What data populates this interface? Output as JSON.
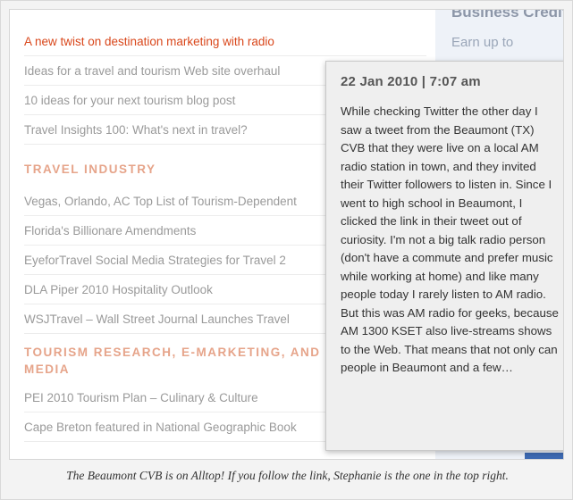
{
  "list": {
    "items_top": [
      "A new twist on destination marketing with radio",
      "Ideas for a travel and tourism Web site overhaul",
      "10 ideas for your next tourism blog post",
      "Travel Insights 100: What's next in travel?"
    ],
    "section_travel_industry": "TRAVEL INDUSTRY",
    "items_industry": [
      "Vegas, Orlando, AC Top List of Tourism-Dependent",
      "Florida's Billionare Amendments",
      "EyeforTravel Social Media Strategies for Travel 2",
      "DLA Piper 2010 Hospitality Outlook",
      "WSJTravel – Wall Street Journal Launches Travel"
    ],
    "section_research": "TOURISM RESEARCH, E-MARKETING, AND SOCIAL MEDIA",
    "items_research": [
      "PEI 2010 Tourism Plan – Culinary & Culture",
      "Cape Breton featured in National Geographic Book"
    ]
  },
  "ad": {
    "title": "Business Credit C",
    "subtitle": "Earn up to"
  },
  "popup": {
    "date": "22 Jan 2010 | 7:07 am",
    "body": "While checking Twitter the other day I saw a tweet from the Beaumont (TX) CVB that they were live on a local AM radio station in town, and they invited their Twitter followers to listen in. Since I went to high school in Beaumont, I clicked the link in their tweet out of curiosity. I'm not a big talk radio person (don't have a commute and prefer music while working at home) and like many people today I rarely listen to AM radio. But this was AM radio for geeks, because AM 1300 KSET also live-streams shows to the Web. That means that not only can people in Beaumont and a few…"
  },
  "caption": "The Beaumont CVB is on Alltop! If you follow the link, Stephanie is the one in the top right.",
  "colors": {
    "active_link": "#d9471b",
    "section_heading": "#e6a48a",
    "link": "#9a9a9a"
  }
}
